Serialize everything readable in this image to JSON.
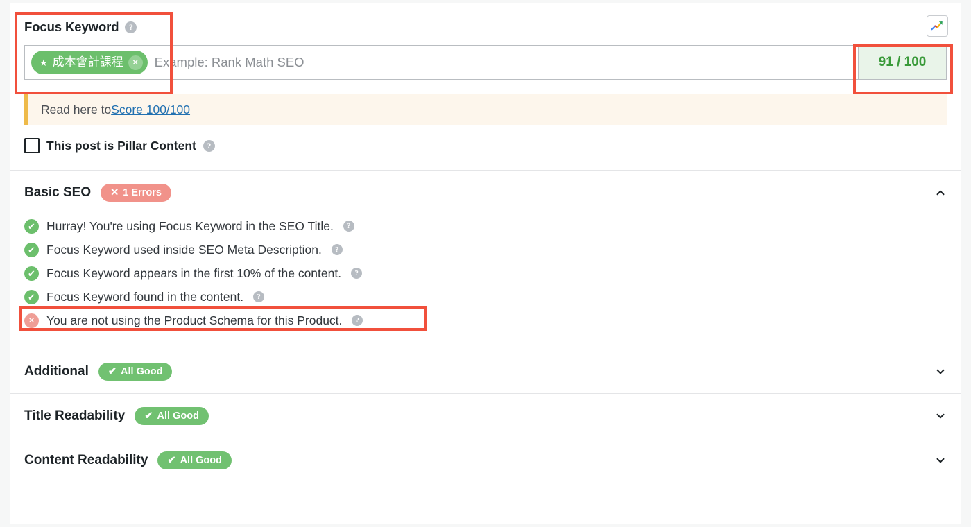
{
  "focus_keyword": {
    "label": "Focus Keyword",
    "help": "?",
    "tag": {
      "star": "★",
      "text": "成本會計課程",
      "remove": "✕"
    },
    "placeholder": "Example: Rank Math SEO",
    "score": "91 / 100",
    "score_color": "#3a9a3a",
    "score_bg": "#e9f4e9"
  },
  "trend_button": {
    "name": "google-trends"
  },
  "notice": {
    "prefix": "Read here to ",
    "link": "Score 100/100"
  },
  "pillar": {
    "label": "This post is Pillar Content",
    "checked": false,
    "help": "?"
  },
  "sections": [
    {
      "title": "Basic SEO",
      "badge": {
        "icon": "✕",
        "label": "1 Errors",
        "type": "error",
        "color": "#f1928a"
      },
      "expanded": true,
      "chevron": "chevron-up",
      "items": [
        {
          "status": "ok",
          "text": "Hurray! You're using Focus Keyword in the SEO Title.",
          "help": "?"
        },
        {
          "status": "ok",
          "text": "Focus Keyword used inside SEO Meta Description.",
          "help": "?"
        },
        {
          "status": "ok",
          "text": "Focus Keyword appears in the first 10% of the content.",
          "help": "?"
        },
        {
          "status": "ok",
          "text": "Focus Keyword found in the content.",
          "help": "?"
        },
        {
          "status": "bad",
          "text": "You are not using the Product Schema for this Product.",
          "help": "?",
          "highlighted": true
        }
      ]
    },
    {
      "title": "Additional",
      "badge": {
        "icon": "✔",
        "label": "All Good",
        "type": "good",
        "color": "#71c171"
      },
      "expanded": false,
      "chevron": "chevron-down",
      "items": []
    },
    {
      "title": "Title Readability",
      "badge": {
        "icon": "✔",
        "label": "All Good",
        "type": "good",
        "color": "#71c171"
      },
      "expanded": false,
      "chevron": "chevron-down",
      "items": []
    },
    {
      "title": "Content Readability",
      "badge": {
        "icon": "✔",
        "label": "All Good",
        "type": "good",
        "color": "#71c171"
      },
      "expanded": false,
      "chevron": "chevron-down",
      "items": []
    }
  ],
  "annotation_color": "#f1503c"
}
